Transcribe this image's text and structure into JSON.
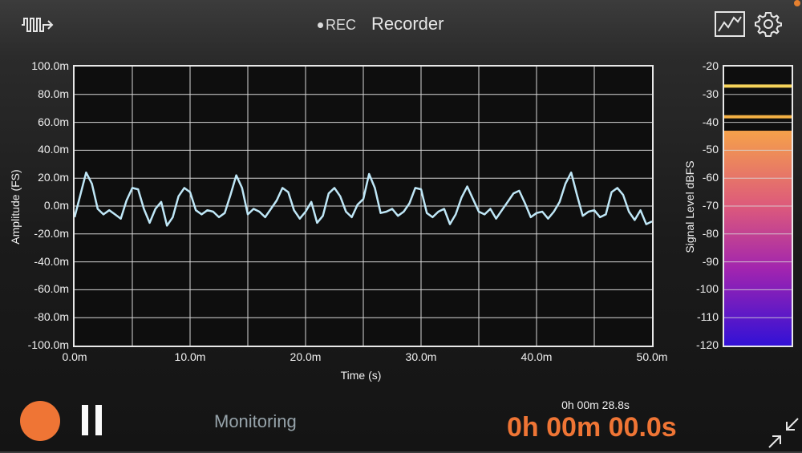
{
  "header": {
    "title": "Recorder",
    "rec_label": "REC"
  },
  "icons": {
    "left": "waveform-arrow-icon",
    "graph": "graph-icon",
    "settings": "gear-icon",
    "collapse": "collapse-arrows-icon"
  },
  "colors": {
    "accent": "#ef7535",
    "trace": "#bfe7f7",
    "monitoring": "#96a3aa",
    "peak_hold": "#f6d35a",
    "peak": "#f3b044"
  },
  "chart_data": [
    {
      "type": "line",
      "xlabel": "Time (s)",
      "ylabel": "Amplitude (FS)",
      "xlim": [
        0,
        0.05
      ],
      "ylim": [
        -0.1,
        0.1
      ],
      "x_ticks": [
        "0.0m",
        "10.0m",
        "20.0m",
        "30.0m",
        "40.0m",
        "50.0m"
      ],
      "y_ticks": [
        "100.0m",
        "80.0m",
        "60.0m",
        "40.0m",
        "20.0m",
        "0.0m",
        "-20.0m",
        "-40.0m",
        "-60.0m",
        "-80.0m",
        "-100.0m"
      ],
      "grid": true,
      "series": [
        {
          "color": "#bfe7f7",
          "x": [
            0,
            0.0005,
            0.001,
            0.0015,
            0.002,
            0.0025,
            0.003,
            0.0035,
            0.004,
            0.0045,
            0.005,
            0.0055,
            0.006,
            0.0065,
            0.007,
            0.0075,
            0.008,
            0.0085,
            0.009,
            0.0095,
            0.01,
            0.0105,
            0.011,
            0.0115,
            0.012,
            0.0125,
            0.013,
            0.0135,
            0.014,
            0.0145,
            0.015,
            0.0155,
            0.016,
            0.0165,
            0.017,
            0.0175,
            0.018,
            0.0185,
            0.019,
            0.0195,
            0.02,
            0.0205,
            0.021,
            0.0215,
            0.022,
            0.0225,
            0.023,
            0.0235,
            0.024,
            0.0245,
            0.025,
            0.0255,
            0.026,
            0.0265,
            0.027,
            0.0275,
            0.028,
            0.0285,
            0.029,
            0.0295,
            0.03,
            0.0305,
            0.031,
            0.0315,
            0.032,
            0.0325,
            0.033,
            0.0335,
            0.034,
            0.0345,
            0.035,
            0.0355,
            0.036,
            0.0365,
            0.037,
            0.0375,
            0.038,
            0.0385,
            0.039,
            0.0395,
            0.04,
            0.0405,
            0.041,
            0.0415,
            0.042,
            0.0425,
            0.043,
            0.0435,
            0.044,
            0.0445,
            0.045,
            0.0455,
            0.046,
            0.0465,
            0.047,
            0.0475,
            0.048,
            0.0485,
            0.049,
            0.0495,
            0.05
          ],
          "y": [
            -0.008,
            0.008,
            0.024,
            0.016,
            -0.002,
            -0.006,
            -0.003,
            -0.006,
            -0.009,
            0.004,
            0.013,
            0.012,
            -0.002,
            -0.012,
            -0.002,
            0.003,
            -0.014,
            -0.008,
            0.007,
            0.013,
            0.01,
            -0.003,
            -0.006,
            -0.003,
            -0.004,
            -0.008,
            -0.005,
            0.008,
            0.022,
            0.013,
            -0.006,
            -0.002,
            -0.004,
            -0.008,
            -0.002,
            0.004,
            0.013,
            0.01,
            -0.003,
            -0.009,
            -0.004,
            0.003,
            -0.012,
            -0.007,
            0.009,
            0.013,
            0.007,
            -0.004,
            -0.008,
            0.001,
            0.005,
            0.023,
            0.013,
            -0.005,
            -0.004,
            -0.002,
            -0.007,
            -0.004,
            0.002,
            0.013,
            0.012,
            -0.005,
            -0.008,
            -0.004,
            -0.002,
            -0.013,
            -0.006,
            0.006,
            0.014,
            0.005,
            -0.004,
            -0.006,
            -0.002,
            -0.009,
            -0.003,
            0.003,
            0.009,
            0.011,
            0.002,
            -0.008,
            -0.005,
            -0.004,
            -0.009,
            -0.004,
            0.003,
            0.016,
            0.024,
            0.008,
            -0.007,
            -0.004,
            -0.003,
            -0.008,
            -0.006,
            0.01,
            0.013,
            0.008,
            -0.004,
            -0.01,
            -0.003,
            -0.013,
            -0.011
          ]
        }
      ]
    },
    {
      "type": "bar",
      "ylabel": "Signal Level dBFS",
      "ylim": [
        -120,
        -20
      ],
      "y_ticks": [
        "-20",
        "-30",
        "-40",
        "-50",
        "-60",
        "-70",
        "-80",
        "-90",
        "-100",
        "-110",
        "-120"
      ],
      "level_db": -43,
      "peak_db": -38,
      "peak_hold_db": -27
    }
  ],
  "controls": {
    "monitoring_label": "Monitoring",
    "total_time": "0h 00m 28.8s",
    "elapsed_time": "0h 00m 00.0s"
  }
}
